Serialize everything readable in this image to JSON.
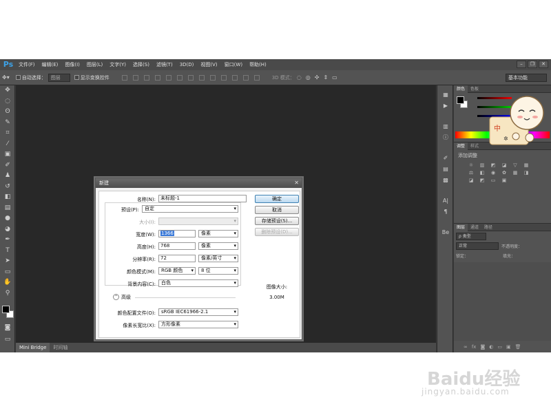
{
  "app": {
    "logo": "Ps",
    "menu": [
      "文件(F)",
      "编辑(E)",
      "图像(I)",
      "图层(L)",
      "文字(Y)",
      "选择(S)",
      "滤镜(T)",
      "3D(D)",
      "视图(V)",
      "窗口(W)",
      "帮助(H)"
    ],
    "window_controls": [
      "–",
      "❐",
      "✕"
    ]
  },
  "options_bar": {
    "auto_select_label": "自动选择：",
    "auto_select_value": "图层",
    "show_transform_label": "显示变换控件",
    "mode_3d_label": "3D 模式：",
    "workspace": "基本功能"
  },
  "bottom_tabs": [
    "Mini Bridge",
    "时间轴"
  ],
  "panels": {
    "color_tabs": [
      "颜色",
      "色板"
    ],
    "adjust_tabs": [
      "调整",
      "样式"
    ],
    "adjust_title": "添加调整",
    "layers_tabs": [
      "图层",
      "通道",
      "路径"
    ],
    "layers_filter": "类型",
    "blend_mode": "正常",
    "opacity_label": "不透明度：",
    "lock_label": "锁定：",
    "fill_label": "填充："
  },
  "dialog": {
    "title": "新建",
    "name_label": "名称(N):",
    "name_value": "未标题-1",
    "preset_label": "预设(P):",
    "preset_value": "自定",
    "size_label": "大小(I):",
    "width_label": "宽度(W):",
    "width_value": "1366",
    "width_unit": "像素",
    "height_label": "高度(H):",
    "height_value": "768",
    "height_unit": "像素",
    "resolution_label": "分辨率(R):",
    "resolution_value": "72",
    "resolution_unit": "像素/英寸",
    "color_mode_label": "颜色模式(M):",
    "color_mode_value": "RGB 颜色",
    "bit_depth_value": "8 位",
    "background_label": "背景内容(C):",
    "background_value": "白色",
    "advanced_label": "高级",
    "profile_label": "颜色配置文件(O):",
    "profile_value": "sRGB IEC61966-2.1",
    "pixel_aspect_label": "像素长宽比(X):",
    "pixel_aspect_value": "方形像素",
    "btn_ok": "确定",
    "btn_cancel": "取消",
    "btn_save_preset": "存储预设(S)...",
    "btn_delete_preset": "删除预设(D)...",
    "image_size_label": "图像大小:",
    "image_size_value": "3.00M"
  },
  "sticker_char": "中",
  "watermark": {
    "logo": "Baidu经验",
    "sub": "jingyan.baidu.com"
  },
  "colors": {
    "accent_blue": "#3a79d8",
    "ps_blue": "#3ca1e6",
    "ui_dark": "#535353",
    "canvas_bg": "#282828"
  }
}
